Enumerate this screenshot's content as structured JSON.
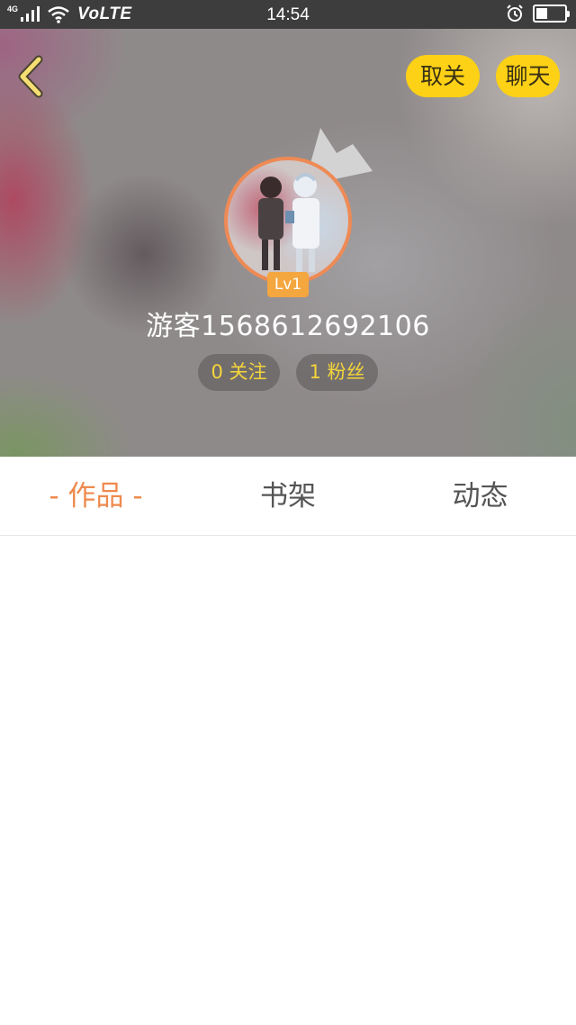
{
  "status_bar": {
    "network": "4G",
    "volte": "VoLTE",
    "time": "14:54",
    "battery_level": 0.4,
    "icons": [
      "signal-icon",
      "wifi-icon",
      "alarm-icon",
      "battery-icon"
    ]
  },
  "header": {
    "back_icon": "chevron-left-icon",
    "unfollow_label": "取关",
    "chat_label": "聊天",
    "level": "Lv1",
    "username": "游客1568612692106",
    "following": "0 关注",
    "fans": "1 粉丝"
  },
  "tabs": [
    {
      "label": "- 作品 -",
      "active": true
    },
    {
      "label": "书架",
      "active": false
    },
    {
      "label": "动态",
      "active": false
    }
  ],
  "colors": {
    "accent": "#ee8a4e",
    "button_yellow": "#fcd116",
    "stat_text": "#f4d53a",
    "level_badge": "#f4a63f"
  }
}
